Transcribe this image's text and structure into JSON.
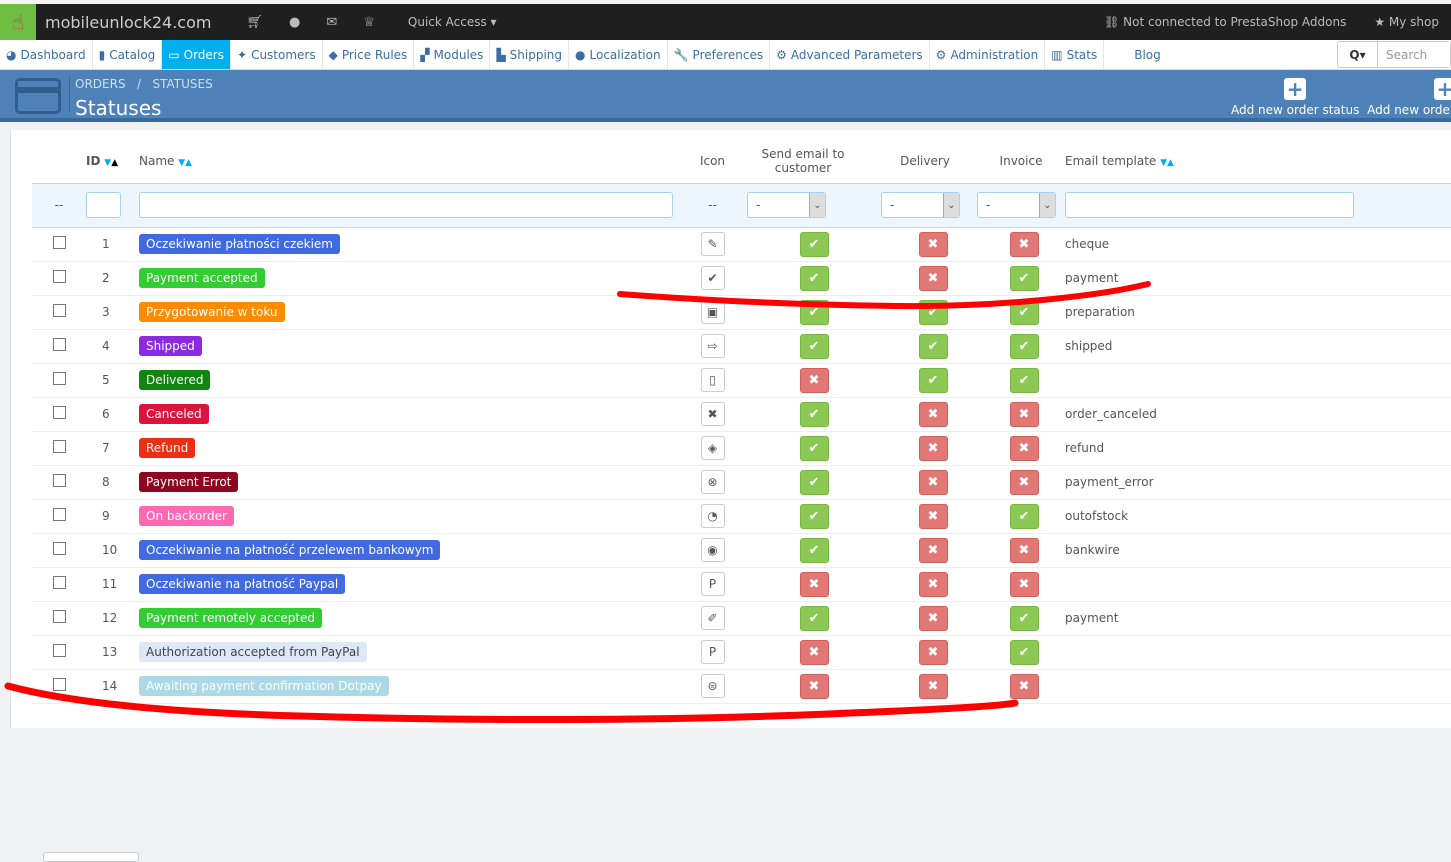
{
  "topbar": {
    "shop_name": "mobileunlock24.com",
    "quick_access": "Quick Access ▾",
    "addons": "Not connected to PrestaShop Addons",
    "my_shop": "My shop"
  },
  "nav": [
    "Dashboard",
    "Catalog",
    "Orders",
    "Customers",
    "Price Rules",
    "Modules",
    "Shipping",
    "Localization",
    "Preferences",
    "Advanced Parameters",
    "Administration",
    "Stats",
    "Blog"
  ],
  "nav_icons": [
    "◕",
    "▮",
    "▭",
    "✦",
    "◆",
    "▞",
    "▙",
    "●",
    "🔧",
    "⚙",
    "⚙",
    "▥",
    ""
  ],
  "search": {
    "placeholder": "Search",
    "button": "Q▾"
  },
  "header": {
    "breadcrumb": "ORDERS   /   STATUSES",
    "title": "Statuses",
    "btn_add_status": "Add new order status",
    "btn_add_return": "Add new order"
  },
  "columns": {
    "id": "ID",
    "name": "Name",
    "icon": "Icon",
    "email": "Send email to customer",
    "delivery": "Delivery",
    "invoice": "Invoice",
    "template": "Email template"
  },
  "filters": {
    "dash": "--",
    "select_value": "-"
  },
  "rows": [
    {
      "id": "1",
      "name": "Oczekiwanie płatności czekiem",
      "color": "#4169e1",
      "icon": "✎",
      "email": true,
      "delivery": false,
      "invoice": false,
      "template": "cheque"
    },
    {
      "id": "2",
      "name": "Payment accepted",
      "color": "#32cd32",
      "icon": "✔",
      "email": true,
      "delivery": false,
      "invoice": true,
      "template": "payment"
    },
    {
      "id": "3",
      "name": "Przygotowanie w toku",
      "color": "#ff8c00",
      "icon": "▣",
      "email": true,
      "delivery": true,
      "invoice": true,
      "template": "preparation"
    },
    {
      "id": "4",
      "name": "Shipped",
      "color": "#8a2be2",
      "icon": "⇨",
      "email": true,
      "delivery": true,
      "invoice": true,
      "template": "shipped"
    },
    {
      "id": "5",
      "name": "Delivered",
      "color": "#108510",
      "icon": "▯",
      "email": false,
      "delivery": true,
      "invoice": true,
      "template": ""
    },
    {
      "id": "6",
      "name": "Canceled",
      "color": "#dc143c",
      "icon": "✖",
      "email": true,
      "delivery": false,
      "invoice": false,
      "template": "order_canceled"
    },
    {
      "id": "7",
      "name": "Refund",
      "color": "#ec2e15",
      "icon": "◈",
      "email": true,
      "delivery": false,
      "invoice": false,
      "template": "refund"
    },
    {
      "id": "8",
      "name": "Payment Errot",
      "color": "#8f0621",
      "icon": "⊗",
      "email": true,
      "delivery": false,
      "invoice": false,
      "template": "payment_error"
    },
    {
      "id": "9",
      "name": "On backorder",
      "color": "#ff69b4",
      "icon": "◔",
      "email": true,
      "delivery": false,
      "invoice": true,
      "template": "outofstock"
    },
    {
      "id": "10",
      "name": "Oczekiwanie na płatność przelewem bankowym",
      "color": "#4169e1",
      "icon": "◉",
      "email": true,
      "delivery": false,
      "invoice": false,
      "template": "bankwire"
    },
    {
      "id": "11",
      "name": "Oczekiwanie na płatność Paypal",
      "color": "#4169e1",
      "icon": "P",
      "email": false,
      "delivery": false,
      "invoice": false,
      "template": ""
    },
    {
      "id": "12",
      "name": "Payment remotely accepted",
      "color": "#32cd32",
      "icon": "✐",
      "email": true,
      "delivery": false,
      "invoice": true,
      "template": "payment"
    },
    {
      "id": "13",
      "name": "Authorization accepted from PayPal",
      "color": "#dde9f7",
      "text_color": "#444",
      "icon": "P",
      "email": false,
      "delivery": false,
      "invoice": true,
      "template": ""
    },
    {
      "id": "14",
      "name": "Awaiting payment confirmation Dotpay",
      "color": "#add8e6",
      "icon": "⊜",
      "email": false,
      "delivery": false,
      "invoice": false,
      "template": ""
    }
  ]
}
